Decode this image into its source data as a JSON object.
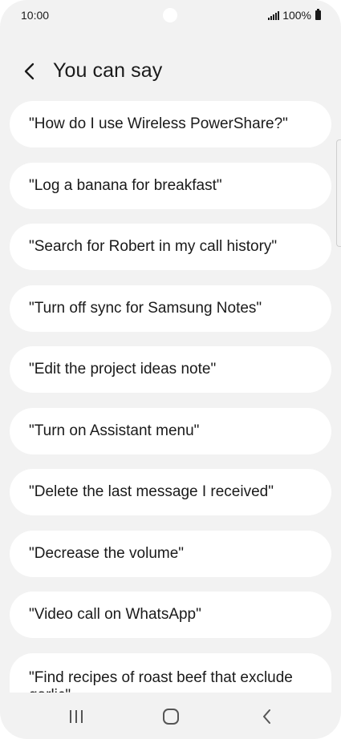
{
  "status_bar": {
    "time": "10:00",
    "battery": "100%"
  },
  "header": {
    "title": "You can say"
  },
  "phrases": [
    "\"How do I use Wireless PowerShare?\"",
    "\"Log a banana for breakfast\"",
    "\"Search for Robert in my call history\"",
    "\"Turn off sync for Samsung Notes\"",
    "\"Edit the project ideas note\"",
    "\"Turn on Assistant menu\"",
    "\"Delete the last message I received\"",
    "\"Decrease the volume\"",
    "\"Video call on WhatsApp\"",
    "\"Find recipes of roast beef that exclude garlic\""
  ],
  "colors": {
    "background": "#f2f2f2",
    "card": "#ffffff",
    "text": "#1a1a1a",
    "nav_icon": "#555555"
  }
}
